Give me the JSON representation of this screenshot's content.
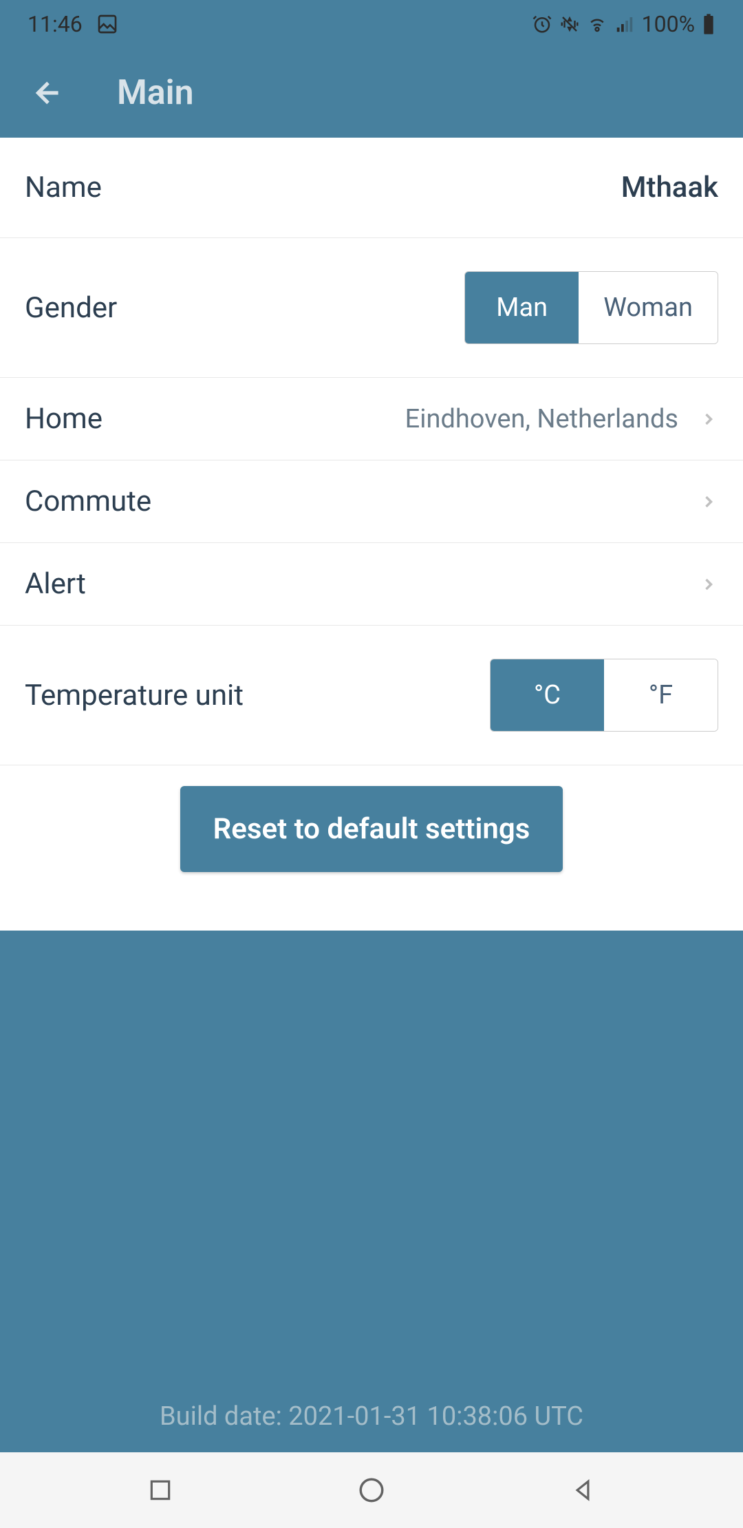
{
  "statusBar": {
    "time": "11:46",
    "battery": "100%"
  },
  "header": {
    "title": "Main"
  },
  "settings": {
    "name": {
      "label": "Name",
      "value": "Mthaak"
    },
    "gender": {
      "label": "Gender",
      "options": {
        "man": "Man",
        "woman": "Woman"
      },
      "selected": "man"
    },
    "home": {
      "label": "Home",
      "value": "Eindhoven, Netherlands"
    },
    "commute": {
      "label": "Commute"
    },
    "alert": {
      "label": "Alert"
    },
    "temperatureUnit": {
      "label": "Temperature unit",
      "options": {
        "celsius": "°C",
        "fahrenheit": "°F"
      },
      "selected": "celsius"
    }
  },
  "resetButton": "Reset to default settings",
  "buildInfo": "Build date: 2021-01-31 10:38:06 UTC"
}
